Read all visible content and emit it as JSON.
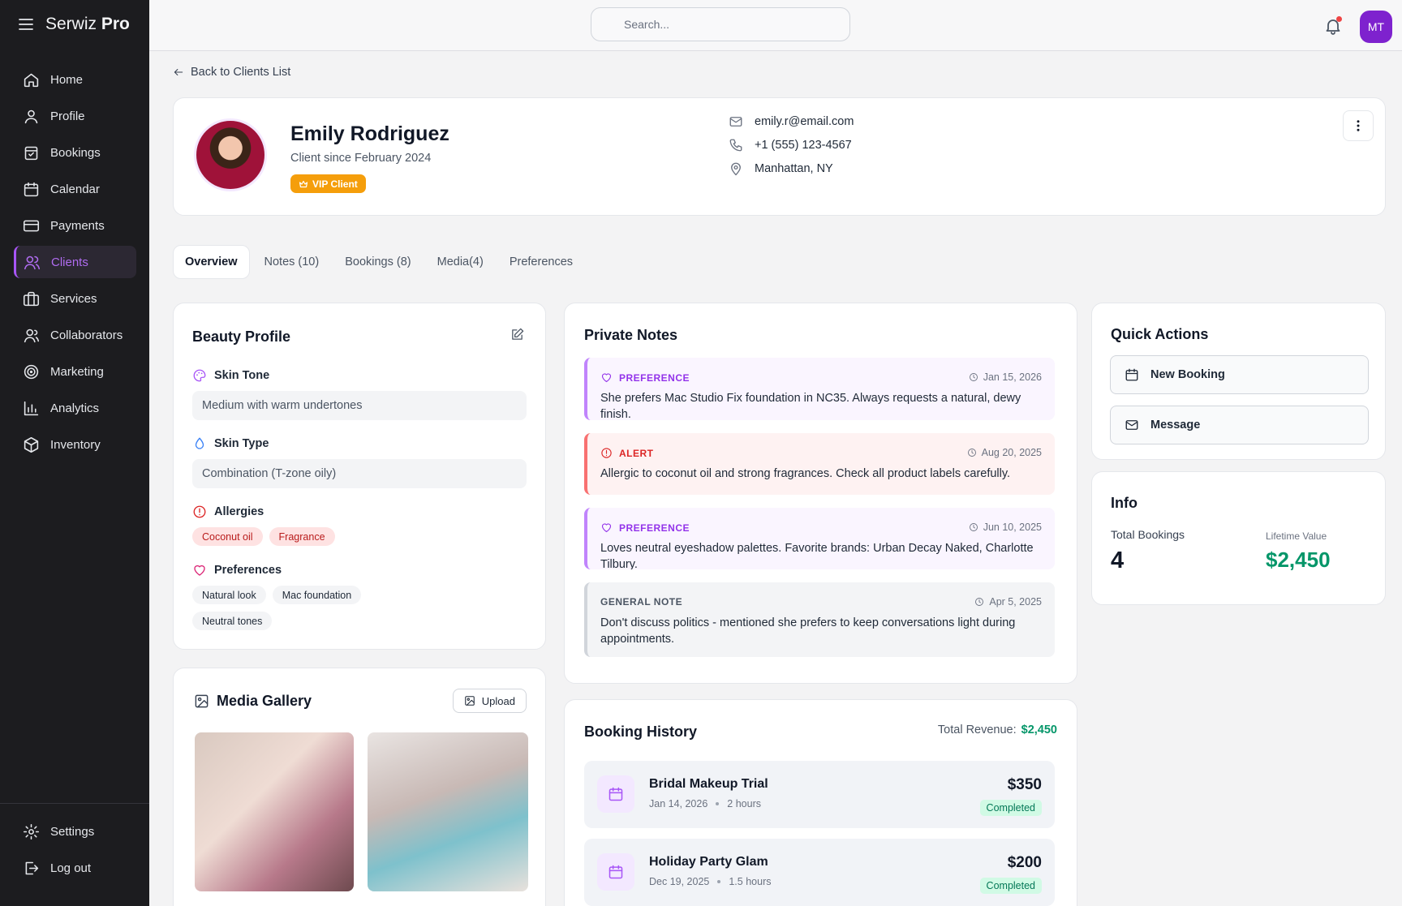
{
  "brand": {
    "name_prefix": "Serwiz",
    "name_bold": "Pro"
  },
  "nav": {
    "items": [
      {
        "label": "Home",
        "icon": "home-icon"
      },
      {
        "label": "Profile",
        "icon": "user-icon"
      },
      {
        "label": "Bookings",
        "icon": "bookings-icon"
      },
      {
        "label": "Calendar",
        "icon": "calendar-icon"
      },
      {
        "label": "Payments",
        "icon": "credit-card-icon"
      },
      {
        "label": "Clients",
        "icon": "users-icon",
        "active": true
      },
      {
        "label": "Services",
        "icon": "briefcase-icon"
      },
      {
        "label": "Collaborators",
        "icon": "collaborators-icon"
      },
      {
        "label": "Marketing",
        "icon": "target-icon"
      },
      {
        "label": "Analytics",
        "icon": "chart-icon"
      },
      {
        "label": "Inventory",
        "icon": "box-icon"
      }
    ],
    "settings": "Settings",
    "logout": "Log out"
  },
  "topbar": {
    "search_placeholder": "Search...",
    "avatar_initials": "MT"
  },
  "back_link": "Back to Clients List",
  "client": {
    "name": "Emily Rodriguez",
    "since": "Client since February 2024",
    "badge": "VIP Client",
    "email": "emily.r@email.com",
    "phone": "+1 (555) 123-4567",
    "location": "Manhattan, NY"
  },
  "tabs": [
    "Overview",
    "Notes (10)",
    "Bookings (8)",
    "Media(4)",
    "Preferences"
  ],
  "beauty_profile": {
    "title": "Beauty Profile",
    "skin_tone_label": "Skin Tone",
    "skin_tone": "Medium with warm undertones",
    "skin_type_label": "Skin Type",
    "skin_type": "Combination (T-zone oily)",
    "allergies_label": "Allergies",
    "allergies": [
      "Coconut oil",
      "Fragrance"
    ],
    "preferences_label": "Preferences",
    "preferences": [
      "Natural look",
      "Mac foundation",
      "Neutral tones"
    ]
  },
  "media_gallery": {
    "title": "Media Gallery",
    "upload": "Upload"
  },
  "private_notes": {
    "title": "Private Notes",
    "items": [
      {
        "type": "PREFERENCE",
        "date": "Jan 15, 2026",
        "text": "She prefers Mac Studio Fix foundation in NC35. Always requests a natural, dewy finish."
      },
      {
        "type": "ALERT",
        "date": "Aug 20, 2025",
        "text": "Allergic to coconut oil and strong fragrances. Check all product labels carefully."
      },
      {
        "type": "PREFERENCE",
        "date": "Jun 10, 2025",
        "text": "Loves neutral eyeshadow palettes. Favorite brands: Urban Decay Naked, Charlotte Tilbury."
      },
      {
        "type": "GENERAL NOTE",
        "date": "Apr 5, 2025",
        "text": "Don't discuss politics - mentioned she prefers to keep conversations light during appointments."
      }
    ]
  },
  "booking_history": {
    "title": "Booking History",
    "revenue_label": "Total Revenue:",
    "revenue": "$2,450",
    "items": [
      {
        "title": "Bridal Makeup Trial",
        "date": "Jan 14, 2026",
        "duration": "2 hours",
        "price": "$350",
        "status": "Completed"
      },
      {
        "title": "Holiday Party Glam",
        "date": "Dec 19, 2025",
        "duration": "1.5 hours",
        "price": "$200",
        "status": "Completed"
      }
    ]
  },
  "quick_actions": {
    "title": "Quick Actions",
    "new_booking": "New Booking",
    "message": "Message"
  },
  "info": {
    "title": "Info",
    "total_bookings_label": "Total Bookings",
    "total_bookings": "4",
    "lifetime_label": "Lifetime Value",
    "lifetime_value": "$2,450"
  },
  "colors": {
    "accent": "#a855f7",
    "vip": "#f59e0b",
    "success": "#059669",
    "alert": "#dc2626"
  }
}
